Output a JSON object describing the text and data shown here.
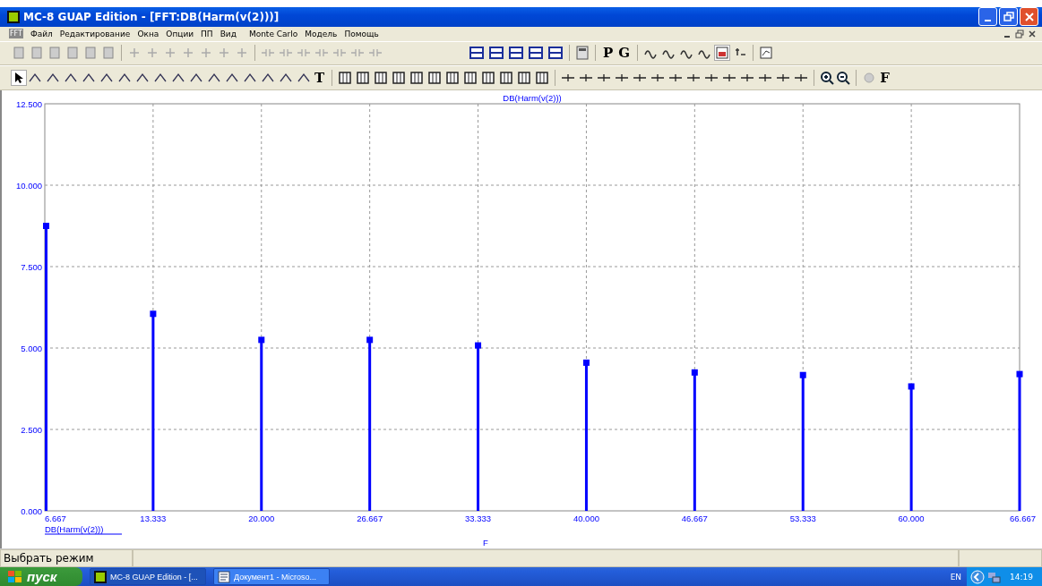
{
  "window": {
    "title": "MC-8 GUAP Edition - [FFT:DB(Harm(v(2)))]"
  },
  "menu": {
    "doc_icon": "FFT",
    "items": [
      "Файл",
      "Редактирование",
      "Окна",
      "Опции",
      "ПП",
      "Вид",
      "Monte Carlo",
      "Модель",
      "Помощь"
    ]
  },
  "toolbar_1": {
    "letter_buttons": [
      "P",
      "G"
    ]
  },
  "toolbar_2": {
    "letter_buttons": [
      "T",
      "F"
    ]
  },
  "plot": {
    "chart_data": {
      "type": "bar",
      "grid": true,
      "title": "DB(Harm(v(2)))",
      "xlabel": "F",
      "categories": [
        "6.667",
        "13.333",
        "20.000",
        "26.667",
        "33.333",
        "40.000",
        "46.667",
        "53.333",
        "60.000",
        "66.667"
      ],
      "series": [
        {
          "name": "DB(Harm(v(2)))",
          "color": "#0000ff",
          "values": [
            8.75,
            6.05,
            5.25,
            5.25,
            5.08,
            4.55,
            4.25,
            4.17,
            3.82,
            4.2
          ]
        }
      ],
      "ylim": [
        0,
        12.5
      ],
      "yticks": [
        {
          "value": 0,
          "label": "0.000"
        },
        {
          "value": 2.5,
          "label": "2.500"
        },
        {
          "value": 5,
          "label": "5.000"
        },
        {
          "value": 7.5,
          "label": "7.500"
        },
        {
          "value": 10,
          "label": "10.000"
        },
        {
          "value": 12.5,
          "label": "12.500"
        }
      ]
    }
  },
  "status_bar": {
    "text": "Выбрать режим"
  },
  "taskbar": {
    "start": "пуск",
    "tasks": [
      {
        "label": "MC-8 GUAP Edition - [...",
        "selected": true
      },
      {
        "label": "Документ1 - Microso...",
        "selected": false
      }
    ],
    "lang": "EN",
    "clock": "14:19"
  }
}
